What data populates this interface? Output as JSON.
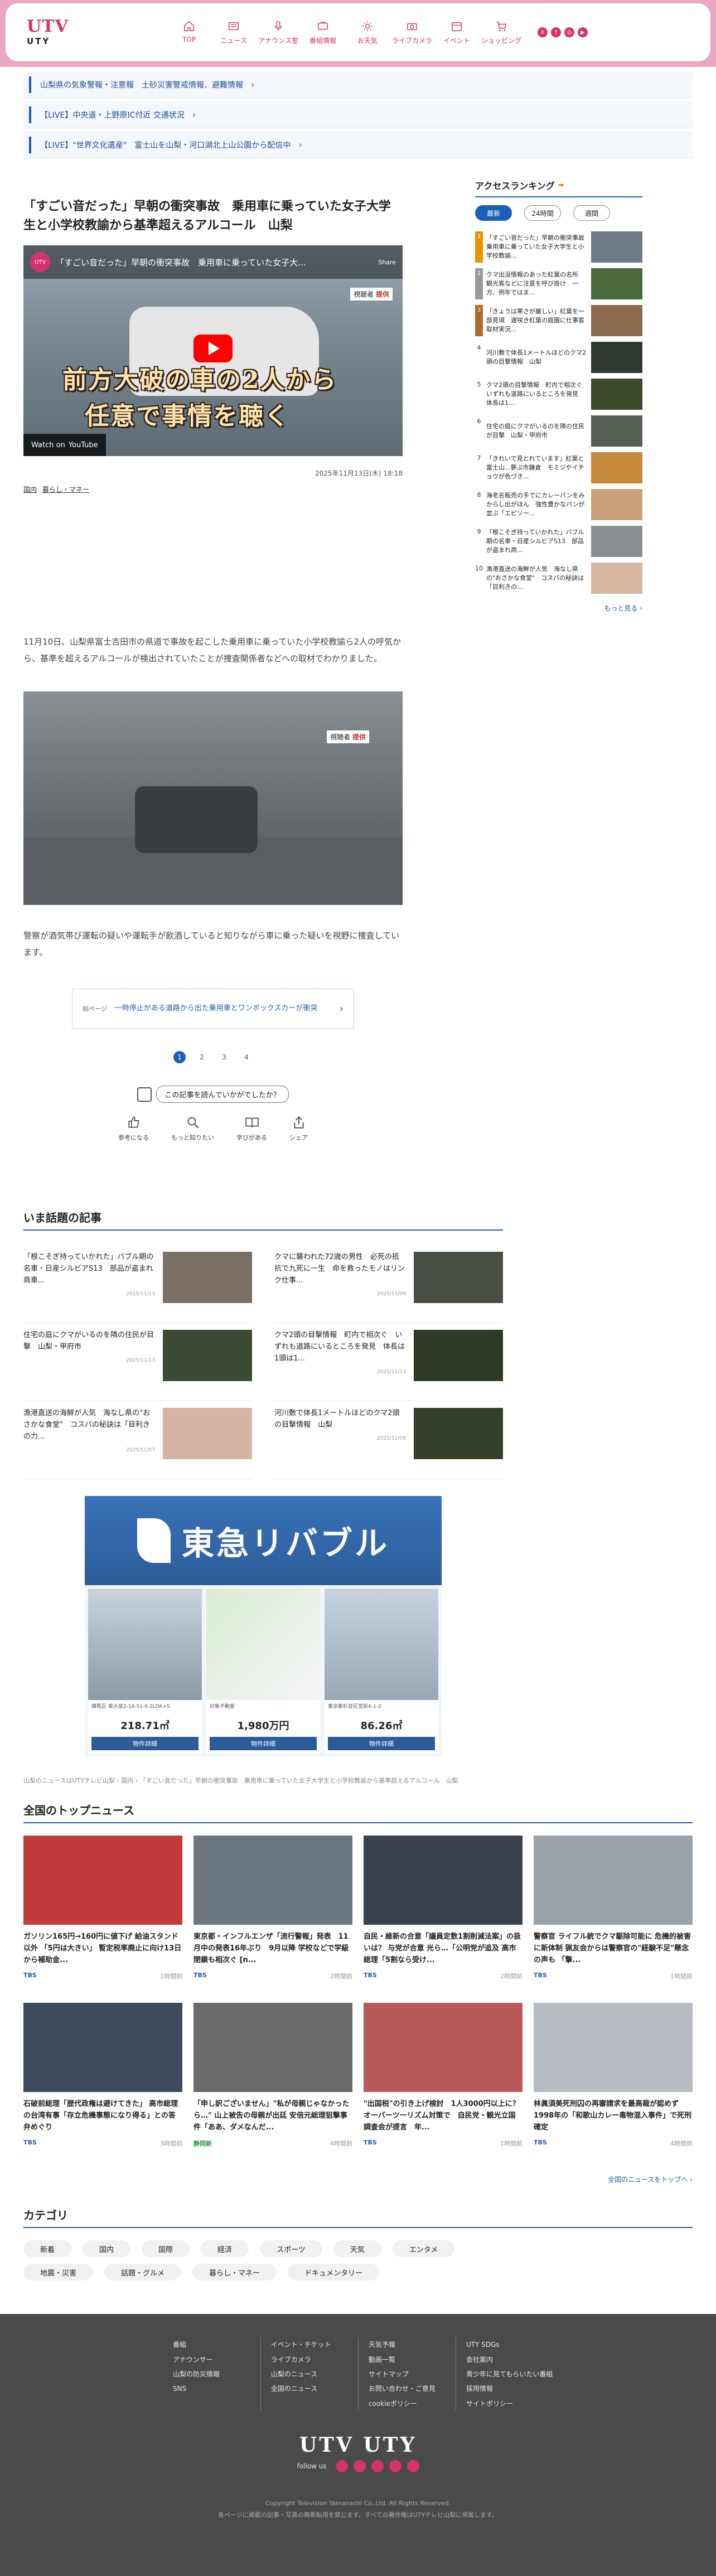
{
  "header": {
    "logo_main": "UTV",
    "logo_sub": "UTY",
    "nav": [
      {
        "label": "TOP",
        "icon": "home-icon"
      },
      {
        "label": "ニュース",
        "icon": "newspaper-icon"
      },
      {
        "label": "アナウンス室",
        "icon": "microphone-icon"
      },
      {
        "label": "番組情報",
        "icon": "tv-icon"
      },
      {
        "label": "お天気",
        "icon": "sun-icon"
      },
      {
        "label": "ライブカメラ",
        "icon": "camera-icon"
      },
      {
        "label": "イベント",
        "icon": "calendar-icon"
      },
      {
        "label": "ショッピング",
        "icon": "cart-icon"
      }
    ],
    "sns": [
      "X",
      "f",
      "◎",
      "▶"
    ]
  },
  "alerts": [
    "山梨県の気象警報・注意報　土砂災害警戒情報、避難情報",
    "【LIVE】中央道・上野原IC付近 交通状況",
    "【LIVE】\"世界文化遺産\"　富士山を山梨・河口湖北上山公園から配信中"
  ],
  "article": {
    "title": "「すごい音だった」早朝の衝突事故　乗用車に乗っていた女子大学生と小学校教諭から基準超えるアルコール　山梨",
    "video": {
      "channel": "UTV",
      "title": "「すごい音だった」早朝の衝突事故　乗用車に乗っていた女子大...",
      "share": "Share",
      "badge_a": "視聴者",
      "badge_b": "提供",
      "caption_1": "前方大破の車の2人から",
      "caption_2": "任意で事情を聴く",
      "watch_on": "Watch on",
      "yt": "YouTube"
    },
    "date": "2025年11月13日(木) 18:18",
    "categories": [
      "国内",
      "暮らし・マネー"
    ],
    "body_1": "11月10日、山梨県富士吉田市の県道で事故を起こした乗用車に乗っていた小学校教諭ら2人の呼気から、基準を超えるアルコールが検出されていたことが捜査関係者などへの取材でわかりました。",
    "image_badge_a": "視聴者",
    "image_badge_b": "提供",
    "body_2": "警察が酒気帯び運転の疑いや運転手が飲酒していると知りながら車に乗った疑いを視野に捜査しています。",
    "prev": {
      "label": "前ページ",
      "title": "一時停止がある道路から出た乗用車とワンボックスカーが衝突"
    },
    "pages": [
      "1",
      "2",
      "3",
      "4"
    ],
    "feedback": {
      "question": "この記事を読んでいかがでしたか？",
      "buttons": [
        "参考になる",
        "もっと知りたい",
        "学びがある",
        "シェア"
      ]
    }
  },
  "ranking": {
    "title": "アクセスランキング",
    "tabs": [
      "最新",
      "24時間",
      "週間"
    ],
    "items": [
      {
        "num": "1",
        "title": "「すごい音だった」早朝の衝突事故　乗用車に乗っていた女子大学生と小学校教諭..."
      },
      {
        "num": "2",
        "title": "クマ出没情報のあった紅葉の名所　観光客などに注意を呼び掛け　一方、例年ではま..."
      },
      {
        "num": "3",
        "title": "「きょうは寒さが厳しい」紅葉を一部見頃　遅咲き紅葉の庭園に仕事客取材実況..."
      },
      {
        "num": "4",
        "title": "河川敷で体長1メートルほどのクマ2頭の目撃情報　山梨"
      },
      {
        "num": "5",
        "title": "クマ2頭の目撃情報　町内で相次ぐ　いずれも道路にいるところを発見　体長は1..."
      },
      {
        "num": "6",
        "title": "住宅の庭にクマがいるのを隣の住民が目撃　山梨・甲府市"
      },
      {
        "num": "7",
        "title": "「きれいで見とれています」紅葉と富士山...夢ぷ市鎌倉　モミジやイチョウが色づき..."
      },
      {
        "num": "8",
        "title": "海老名販売の手でにカレーパンをみからし出がほん　強性豊かなパンが並ぶ「エピソー..."
      },
      {
        "num": "9",
        "title": "「根こそぎ持っていかれた」バブル期の名車・日産シルビアS13　部品が盗まれ商..."
      },
      {
        "num": "10",
        "title": "漁港直送の海鮮が人気　海なし県の\"おさかな食堂\"　コスパの秘訣は「目利きの..."
      }
    ],
    "more": "もっと見る ›"
  },
  "topics": {
    "title": "いま話題の記事",
    "items": [
      {
        "title": "「根こそぎ持っていかれた」バブル期の名車・日産シルビアS13　部品が盗まれ商車...",
        "date": "2025/11/13"
      },
      {
        "title": "クマに襲われた72歳の男性　必死の抵抗で九死に一生　命を救ったモノはリンク仕事...",
        "date": "2025/11/09"
      },
      {
        "title": "住宅の庭にクマがいるのを隣の住民が目撃　山梨・甲府市",
        "date": "2025/11/13"
      },
      {
        "title": "クマ2頭の目撃情報　町内で相次ぐ　いずれも道路にいるところを発見　体長は1頭は1...",
        "date": "2025/11/13"
      },
      {
        "title": "漁港直送の海鮮が人気　海なし県の\"おさかな食堂\"　コスパの秘訣は「目利きの力...",
        "date": "2025/11/07"
      },
      {
        "title": "河川敷で体長1メートルほどのクマ2頭の目撃情報　山梨",
        "date": "2025/11/09"
      }
    ]
  },
  "ad": {
    "brand": "東急リバブル",
    "cards": [
      {
        "caption": "練馬区 東大泉2-18-51-8 2LDK+S",
        "price": "218.71㎡",
        "button": "物件詳細"
      },
      {
        "caption": "対象不動産",
        "price": "1,980万円",
        "button": "物件詳細"
      },
      {
        "caption": "東京都杉並区宮前4-1-2",
        "price": "86.26㎡",
        "button": "物件詳細"
      }
    ]
  },
  "breadcrumb": "山梨のニュースはUTYテレビ山梨 › 国内 › 「すごい音だった」早朝の衝突事故　乗用車に乗っていた女子大学生と小学校教諭から基準超えるアルコール　山梨",
  "national": {
    "title": "全国のトップニュース",
    "items": [
      {
        "title": "ガソリン165円→160円に値下げ 給油スタンド以外 「5円は大きい」 暫定税率廃止に向け13日から補助金...",
        "src": "TBS",
        "time": "1時間前"
      },
      {
        "title": "東京都・インフルエンザ「流行警報」発表　11月中の発表16年ぶり　9月以降 学校などで学級閉鎖も相次ぐ [n...",
        "src": "TBS",
        "time": "2時間前"
      },
      {
        "title": "自民・維新の合意「議員定数1割削減法案」の扱いは？ 与党が合意 光ら…「公明党が追及 高市総理「5割なら受け...",
        "src": "TBS",
        "time": "2時間前"
      },
      {
        "title": "警察官 ライフル銃でクマ駆除可能に 危機的被害に新体制 猟友会からは警察官の\"経験不足\"懸念の声も 「撃...",
        "src": "TBS",
        "time": "1時間前"
      },
      {
        "title": "石破前総理「歴代政権は避けてきた」 高市総理の台湾有事「存立危機事態になり得る」との答弁めぐり",
        "src": "TBS",
        "time": "3時間前"
      },
      {
        "title": "「申し訳ございません」\"私が母親じゃなかったら…\" 山上被告の母親が出廷 安倍元総理狙撃事件「ああ、ダメなんだ...",
        "src": "静岡新",
        "time": "4時間前"
      },
      {
        "title": "\"出国税\"の引き上げ検討　1人3000円以上に？　オーバーツーリズム対策で　自民党・観光立国調査会が提言　年...",
        "src": "TBS",
        "time": "1時間前"
      },
      {
        "title": "林眞須美死刑囚の再審請求を最高裁が認めず　1998年の「和歌山カレー毒物混入事件」で死刑確定",
        "src": "TBS",
        "time": "4時間前"
      }
    ],
    "more": "全国のニュースをトップへ ›"
  },
  "category": {
    "title": "カテゴリ",
    "chips": [
      "新着",
      "国内",
      "国際",
      "経済",
      "スポーツ",
      "天気",
      "エンタメ",
      "地震・災害",
      "話題・グルメ",
      "暮らし・マネー",
      "ドキュメンタリー"
    ]
  },
  "footer": {
    "cols": [
      [
        "番組",
        "アナウンサー",
        "山梨の防災情報",
        "SNS"
      ],
      [
        "イベント・チケット",
        "ライブカメラ",
        "山梨のニュース",
        "全国のニュース"
      ],
      [
        "天気予報",
        "動画一覧",
        "サイトマップ",
        "お問い合わせ・ご意見",
        "cookieポリシー"
      ],
      [
        "UTY SDGs",
        "会社案内",
        "青少年に見てもらいたい番組",
        "採用情報",
        "サイトポリシー"
      ]
    ],
    "logo": "UTV UTY",
    "follow": "follow us",
    "copyright": "Copyright Television Yamanashi Co.,Ltd. All Rights Reserved.",
    "notice": "各ページに掲載の記事・写真の無断転用を禁じます。すべての著作権はUTYテレビ山梨に帰属します。"
  }
}
